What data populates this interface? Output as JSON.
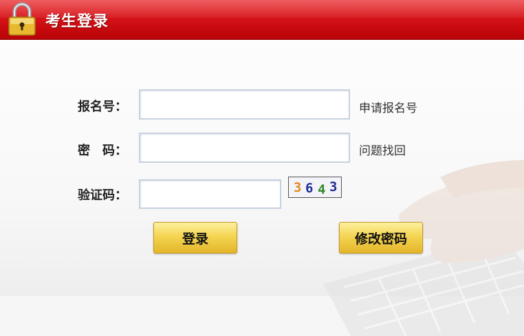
{
  "header": {
    "title": "考生登录"
  },
  "form": {
    "reg_label": "报名号：",
    "reg_link": "申请报名号",
    "pwd_label": "密　码：",
    "pwd_link": "问题找回",
    "captcha_label": "验证码：",
    "captcha_text": [
      "3",
      "6",
      "4",
      "3"
    ],
    "captcha_colors": [
      "#e08a1e",
      "#1b2f9c",
      "#2f8a2a",
      "#1d2a8a"
    ]
  },
  "buttons": {
    "login": "登录",
    "change_password": "修改密码"
  }
}
